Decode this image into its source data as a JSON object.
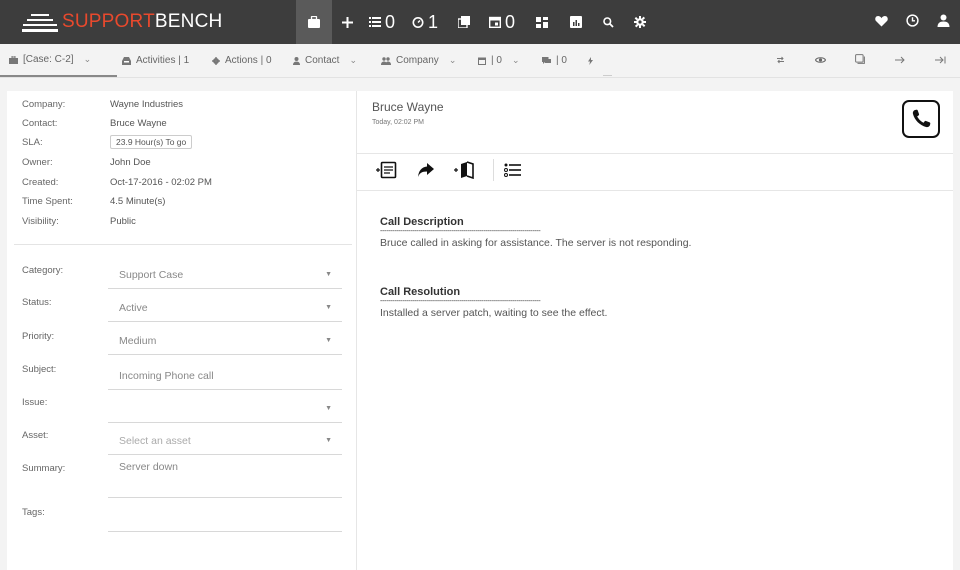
{
  "app": {
    "brand_part1": "SUPPORT",
    "brand_part2": "BENCH"
  },
  "nav": {
    "list_count": "0",
    "timer_count": "1",
    "calendar_count": "0"
  },
  "tabs": {
    "case": "[Case: C-2]",
    "activities": "Activities | 1",
    "actions": "Actions | 0",
    "contact": "Contact",
    "company": "Company",
    "cal_count": "| 0",
    "chat_count": "| 0"
  },
  "case_info": {
    "company_label": "Company:",
    "company": "Wayne Industries",
    "contact_label": "Contact:",
    "contact": "Bruce Wayne",
    "sla_label": "SLA:",
    "sla": "23.9 Hour(s) To go",
    "owner_label": "Owner:",
    "owner": "John Doe",
    "created_label": "Created:",
    "created": "Oct-17-2016 - 02:02 PM",
    "time_spent_label": "Time Spent:",
    "time_spent": "4.5 Minute(s)",
    "visibility_label": "Visibility:",
    "visibility": "Public"
  },
  "form": {
    "category_label": "Category:",
    "category": "Support Case",
    "status_label": "Status:",
    "status": "Active",
    "priority_label": "Priority:",
    "priority": "Medium",
    "subject_label": "Subject:",
    "subject": "Incoming Phone call",
    "issue_label": "Issue:",
    "issue": "",
    "asset_label": "Asset:",
    "asset_placeholder": "Select an asset",
    "summary_label": "Summary:",
    "summary": "Server down",
    "tags_label": "Tags:",
    "tags": ""
  },
  "activity": {
    "author": "Bruce Wayne",
    "timestamp": "Today, 02:02 PM",
    "call_description_title": "Call Description",
    "divider": "-------------------------------------------------------------------------------",
    "call_description": "Bruce called in asking for assistance.  The server is not responding.",
    "call_resolution_title": "Call Resolution",
    "call_resolution": "Installed a server patch, waiting to see the effect."
  }
}
